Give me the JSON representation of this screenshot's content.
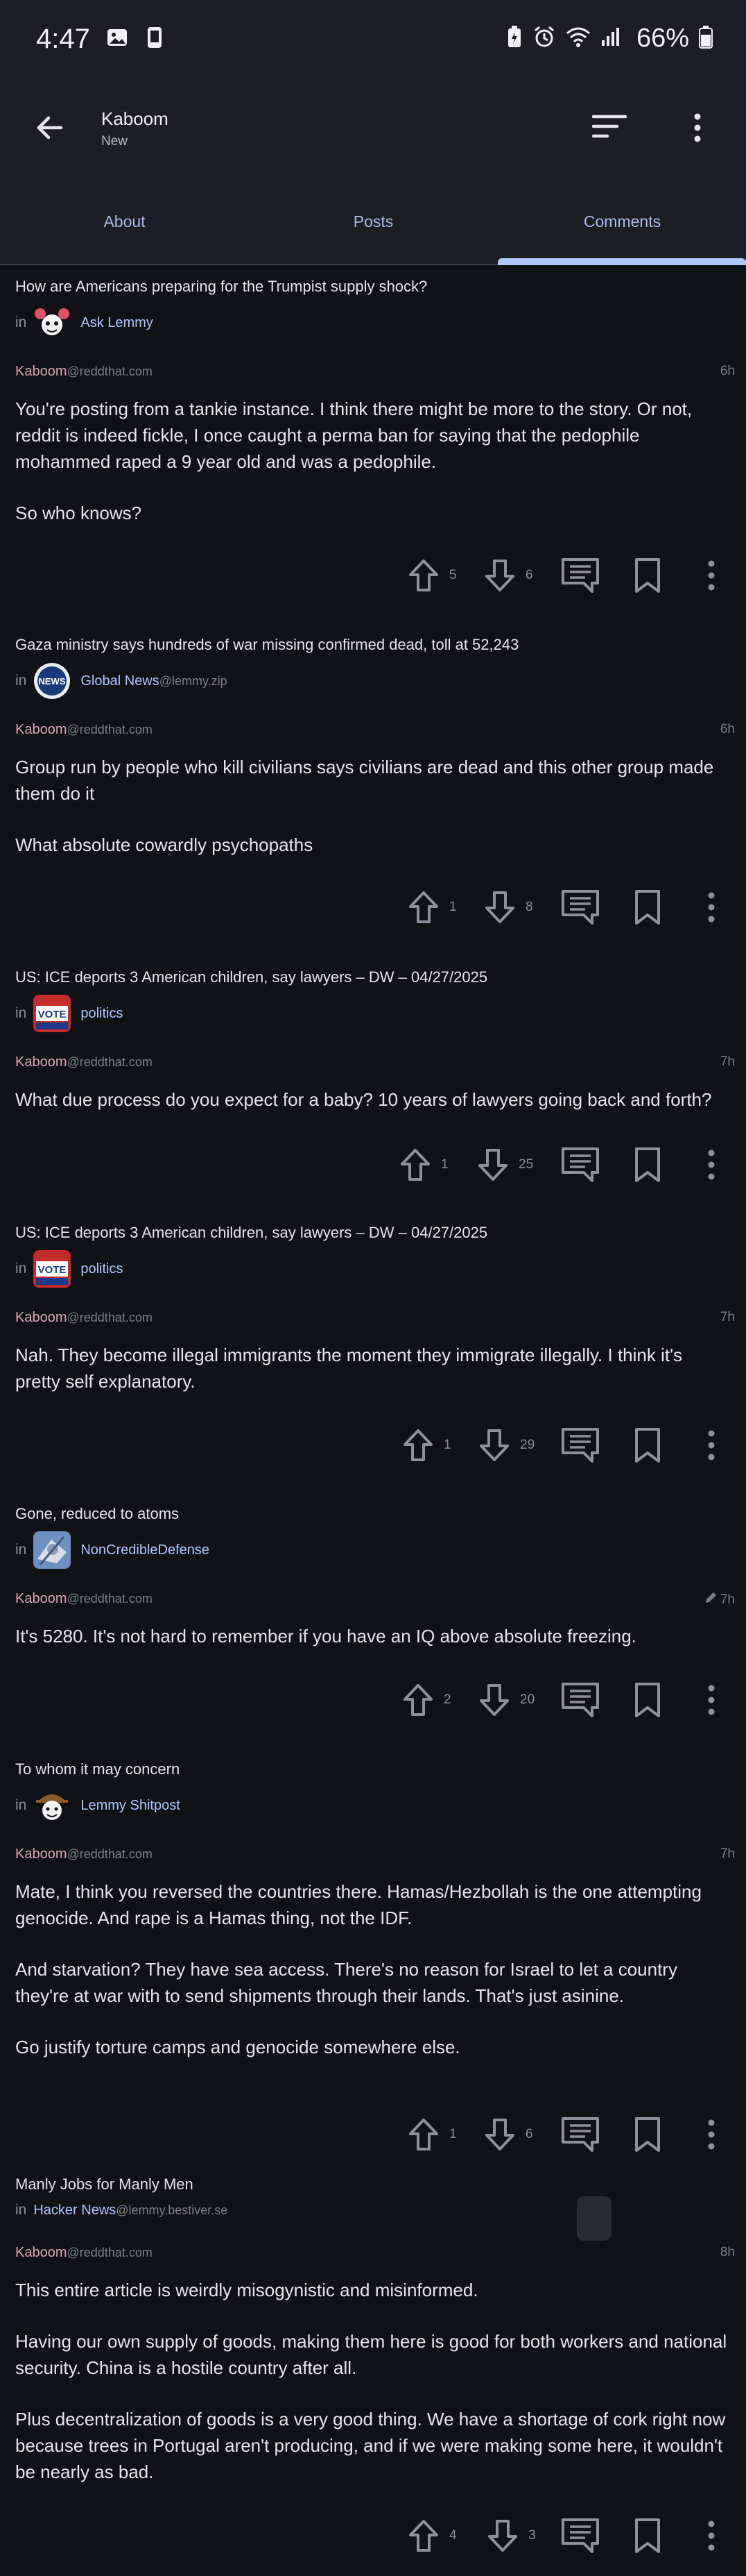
{
  "status_bar": {
    "time": "4:47",
    "battery": "66%"
  },
  "app_bar": {
    "title": "Kaboom",
    "subtitle": "New"
  },
  "tabs": [
    {
      "label": "About"
    },
    {
      "label": "Posts"
    },
    {
      "label": "Comments"
    }
  ],
  "comments": [
    {
      "post_title": "How are Americans preparing for the Trumpist supply shock?",
      "community": "Ask Lemmy",
      "community_instance": "",
      "author": "Kaboom",
      "author_instance": "@reddthat.com",
      "time": "6h",
      "paragraphs": [
        "You're posting from a tankie instance. I think there might be more to the story. Or not, reddit is indeed fickle, I once caught a perma ban for saying that the pedophile mohammed raped a 9 year old and was a pedophile.",
        "So who knows?"
      ],
      "upvotes": "5",
      "downvotes": "6"
    },
    {
      "post_title": "Gaza ministry says hundreds of war missing confirmed dead, toll at 52,243",
      "community": "Global News",
      "community_instance": "@lemmy.zip",
      "author": "Kaboom",
      "author_instance": "@reddthat.com",
      "time": "6h",
      "paragraphs": [
        "Group run by people who kill civilians says civilians are dead and this other group made them do it",
        "What absolute cowardly psychopaths"
      ],
      "upvotes": "1",
      "downvotes": "8"
    },
    {
      "post_title": "US: ICE deports 3 American children, say lawyers – DW – 04/27/2025",
      "community": "politics",
      "community_instance": "",
      "author": "Kaboom",
      "author_instance": "@reddthat.com",
      "time": "7h",
      "paragraphs": [
        "What due process do you expect for a baby? 10 years of lawyers going back and forth?"
      ],
      "upvotes": "1",
      "downvotes": "25"
    },
    {
      "post_title": "US: ICE deports 3 American children, say lawyers – DW – 04/27/2025",
      "community": "politics",
      "community_instance": "",
      "author": "Kaboom",
      "author_instance": "@reddthat.com",
      "time": "7h",
      "paragraphs": [
        "Nah. They become illegal immigrants the moment they immigrate illegally. I think it's pretty self explanatory."
      ],
      "upvotes": "1",
      "downvotes": "29"
    },
    {
      "post_title": "Gone, reduced to atoms",
      "community": "NonCredibleDefense",
      "community_instance": "",
      "author": "Kaboom",
      "author_instance": "@reddthat.com",
      "time": "7h",
      "paragraphs": [
        "It's 5280. It's not hard to remember if you have an IQ above absolute freezing."
      ],
      "upvotes": "2",
      "downvotes": "20"
    },
    {
      "post_title": "To whom it may concern",
      "community": "Lemmy Shitpost",
      "community_instance": "",
      "author": "Kaboom",
      "author_instance": "@reddthat.com",
      "time": "7h",
      "paragraphs": [
        "Mate, I think you reversed the countries there. Hamas/Hezbollah is the one attempting genocide. And rape is a Hamas thing, not the IDF.",
        "And starvation? They have sea access. There's no reason for Israel to let a country they're at war with to send shipments through their lands. That's just asinine.",
        "Go justify torture camps and genocide somewhere else."
      ],
      "upvotes": "1",
      "downvotes": "6"
    },
    {
      "post_title": "Manly Jobs for Manly Men",
      "community": "Hacker News",
      "community_instance": "@lemmy.bestiver.se",
      "author": "Kaboom",
      "author_instance": "@reddthat.com",
      "time": "8h",
      "paragraphs": [
        "This entire article is weirdly misogynistic and misinformed.",
        "Having our own supply of goods, making them here is good for both workers and national security. China is a hostile country after all.",
        "Plus decentralization of goods is a very good thing. We have a shortage of cork right now because trees in Portugal aren't producing, and if we were making some here, it wouldn't be nearly as bad."
      ],
      "upvotes": "4",
      "downvotes": "3"
    }
  ],
  "colors": {
    "background": "#111216",
    "bar": "#1d1e23",
    "accent": "#afc6ff",
    "author": "#d9a8b4",
    "muted": "#7c7d86"
  }
}
